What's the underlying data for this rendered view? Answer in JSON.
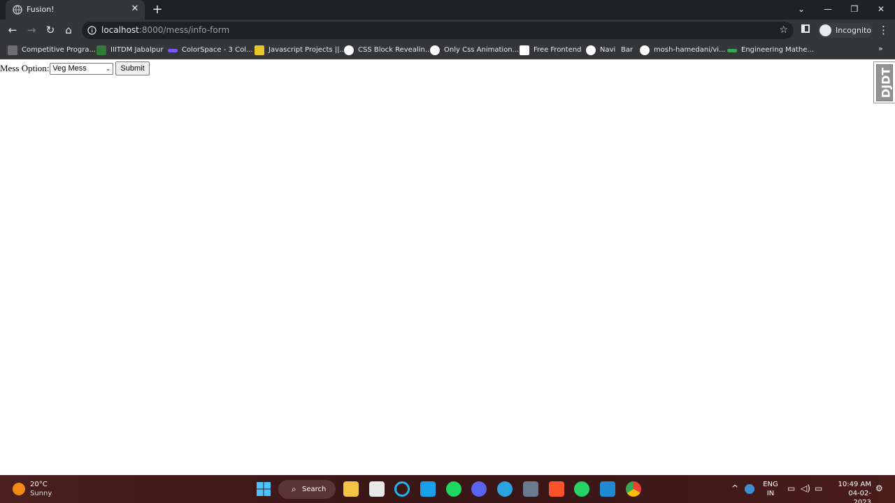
{
  "browser": {
    "tab_title": "Fusion!",
    "url_host": "localhost",
    "url_path": ":8000/mess/info-form",
    "incognito_label": "Incognito"
  },
  "bookmarks": [
    {
      "label": "Competitive Progra...",
      "color": "#6d6d6d"
    },
    {
      "label": "IIITDM Jabalpur",
      "color": "#2f7a3a"
    },
    {
      "label": "ColorSpace - 3 Col...",
      "color": "#7b57ff"
    },
    {
      "label": "Javascript Projects ||...",
      "color": "#e6c628"
    },
    {
      "label": "CSS Block Revealin...",
      "color": "#ffffff"
    },
    {
      "label": "Only Css Animation...",
      "color": "#ffffff"
    },
    {
      "label": "Free Frontend",
      "color": "#ffffff"
    },
    {
      "label": "Navi",
      "color": "#ffffff"
    },
    {
      "label": "Bar",
      "color": "transparent"
    },
    {
      "label": "mosh-hamedani/vi...",
      "color": "#ffffff"
    },
    {
      "label": "Engineering Mathe...",
      "color": "#3aa55a"
    }
  ],
  "form": {
    "label": "Mess Option:",
    "select_value": "Veg Mess",
    "submit_label": "Submit"
  },
  "debug_toolbar": {
    "label": "DJDT"
  },
  "taskbar": {
    "temperature": "20°C",
    "condition": "Sunny",
    "search_label": "Search",
    "lang_line1": "ENG",
    "lang_line2": "IN",
    "time": "10:49 AM",
    "date": "04-02-2023"
  }
}
